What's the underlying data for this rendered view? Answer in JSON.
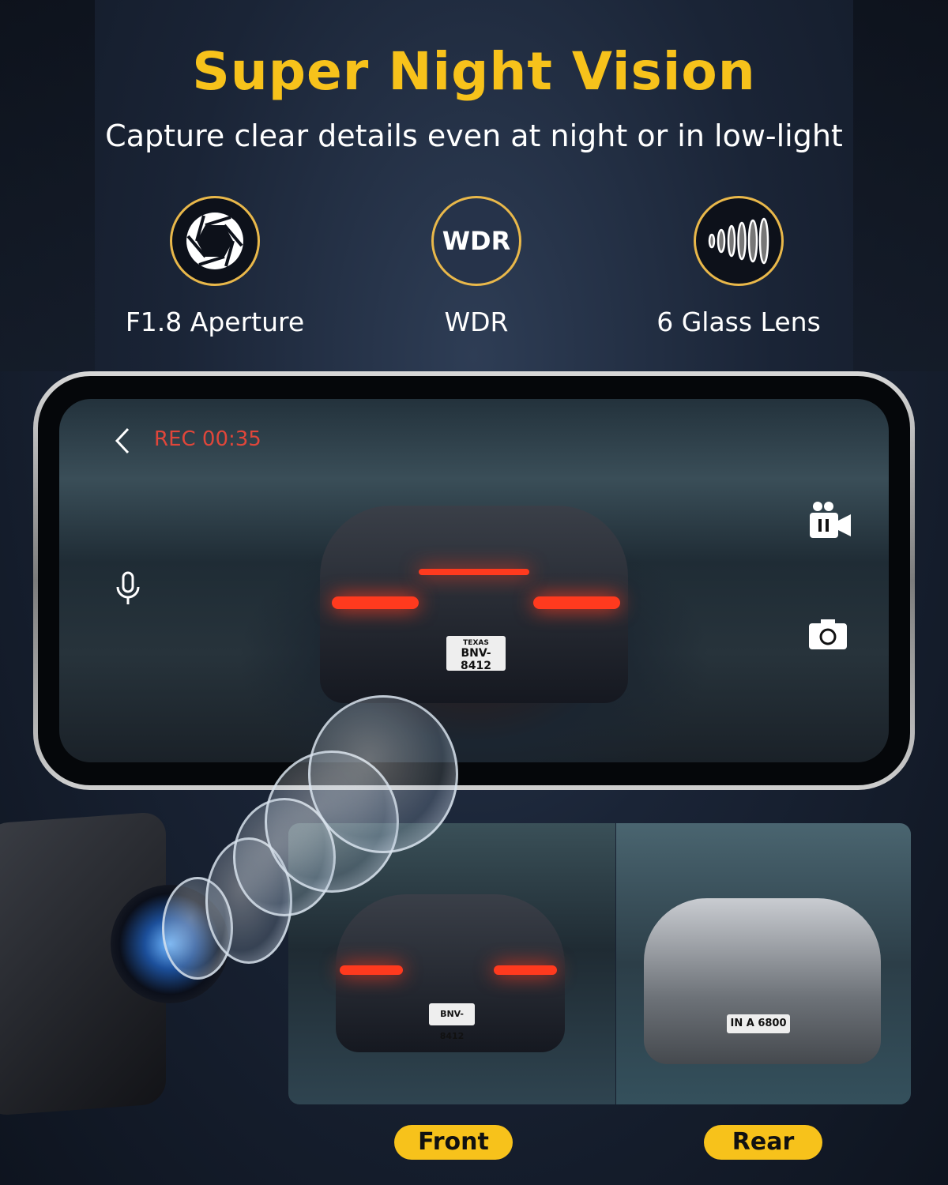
{
  "header": {
    "title": "Super Night Vision",
    "subtitle": "Capture clear details even at night or in low-light"
  },
  "features": [
    {
      "icon": "aperture-icon",
      "label": "F1.8 Aperture"
    },
    {
      "icon": "wdr-icon",
      "icon_text": "WDR",
      "label": "WDR"
    },
    {
      "icon": "glass-lens-icon",
      "label": "6 Glass Lens"
    }
  ],
  "phone": {
    "rec_label": "REC 00:35",
    "plate_state": "TEXAS",
    "plate": "BNV-8412",
    "icons": [
      "back-chevron-icon",
      "microphone-icon",
      "video-pause-icon",
      "camera-icon"
    ]
  },
  "views": {
    "front_label": "Front",
    "rear_label": "Rear",
    "front_plate": "BNV-8412",
    "rear_plate": "IN A 6800"
  },
  "colors": {
    "accent": "#f7c21b",
    "rec": "#e0463a",
    "ring": "#e9b84a"
  }
}
